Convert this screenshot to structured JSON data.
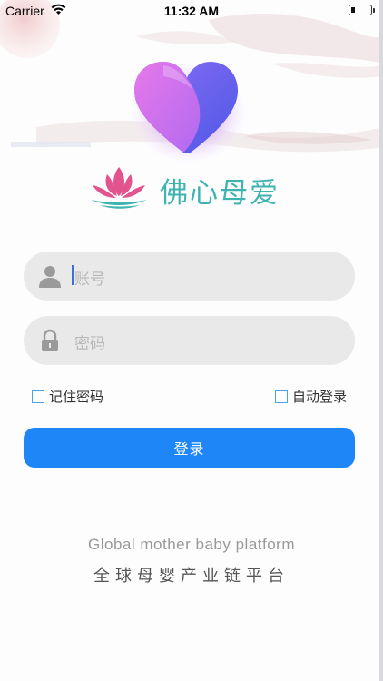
{
  "status_bar": {
    "carrier": "Carrier",
    "time": "11:32 AM",
    "battery_level": 0.2
  },
  "logo": {
    "app_name": "佛心母爱",
    "heart_icon": "heart-logo-icon",
    "lotus_icon": "lotus-logo-icon"
  },
  "form": {
    "account": {
      "placeholder": "账号",
      "icon": "user-icon"
    },
    "password": {
      "placeholder": "密码",
      "icon": "lock-icon"
    },
    "remember_label": "记住密码",
    "auto_login_label": "自动登录",
    "login_button": "登录"
  },
  "footer": {
    "slogan_en": "Global mother baby platform",
    "slogan_zh": "全球母婴产业链平台"
  },
  "colors": {
    "primary": "#1E86F7",
    "brand_text": "#3FB3B0",
    "lotus": "#E2548E"
  }
}
